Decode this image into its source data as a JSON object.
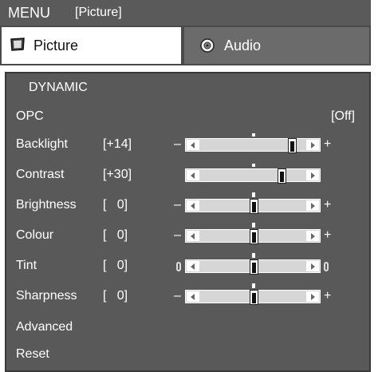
{
  "header": {
    "menu_label": "MENU",
    "crumb": "[Picture]"
  },
  "tabs": [
    {
      "label": "Picture",
      "icon": "monitor-icon",
      "active": true
    },
    {
      "label": "Audio",
      "icon": "speaker-icon",
      "active": false
    }
  ],
  "mode": "DYNAMIC",
  "opc": {
    "label": "OPC",
    "value": "[Off]"
  },
  "sliders": [
    {
      "label": "Backlight",
      "value": "[+14]",
      "minus": "–",
      "plus": "+",
      "level": 0.86
    },
    {
      "label": "Contrast",
      "value": "[+30]",
      "minus": "",
      "plus": "",
      "level": 0.76
    },
    {
      "label": "Brightness",
      "value": "[   0]",
      "minus": "–",
      "plus": "+",
      "level": 0.5
    },
    {
      "label": "Colour",
      "value": "[   0]",
      "minus": "–",
      "plus": "+",
      "level": 0.5
    },
    {
      "label": "Tint",
      "value": "[   0]",
      "minus": "",
      "plus": "",
      "level": 0.5
    },
    {
      "label": "Sharpness",
      "value": "[   0]",
      "minus": "–",
      "plus": "+",
      "level": 0.5
    }
  ],
  "advanced_label": "Advanced",
  "reset_label": "Reset",
  "colors": {
    "menubar": "#5a5a5a",
    "panel": "#595959",
    "tab_inactive": "#6b6b6b",
    "slider_track": "#d6d6d6"
  }
}
